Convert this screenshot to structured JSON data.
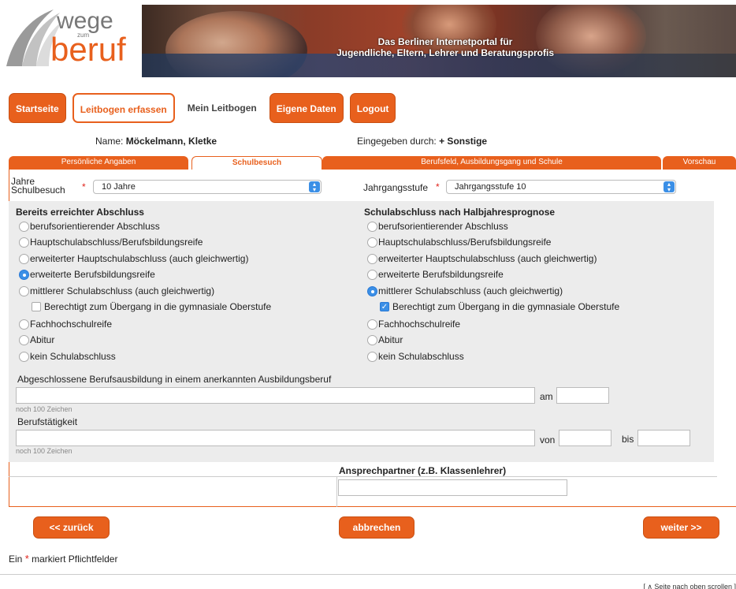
{
  "header": {
    "logo_top": "wege",
    "logo_mid": "zum",
    "logo_bottom": "beruf",
    "banner_line1": "Das Berliner Internetportal für",
    "banner_line2": "Jugendliche, Eltern, Lehrer und Beratungsprofis"
  },
  "nav": {
    "startseite": "Startseite",
    "leitbogen_erfassen": "Leitbogen erfassen",
    "mein_leitbogen": "Mein Leitbogen",
    "eigene_daten": "Eigene Daten",
    "logout": "Logout"
  },
  "info": {
    "name_label": "Name:",
    "name_value": "Möckelmann, Kletke",
    "entered_label": "Eingegeben durch:",
    "entered_value": "+ Sonstige"
  },
  "tabs": [
    {
      "label": "Persönliche Angaben"
    },
    {
      "label": "Schulbesuch"
    },
    {
      "label": "Berufsfeld, Ausbildungsgang und Schule"
    },
    {
      "label": "Vorschau"
    }
  ],
  "form": {
    "jahre_label_1": "Jahre",
    "jahre_label_2": "Schulbesuch",
    "jahre_value": "10 Jahre",
    "jahrgang_label": "Jahrgangsstufe",
    "jahrgang_value": "Jahrgangsstufe 10",
    "left_title": "Bereits erreichter Abschluss",
    "right_title": "Schulabschluss nach Halbjahresprognose",
    "left_options": [
      {
        "label": "berufsorientierender Abschluss",
        "selected": false
      },
      {
        "label": "Hauptschulabschluss/Berufsbildungsreife",
        "selected": false
      },
      {
        "label": "erweiterter Hauptschulabschluss (auch gleichwertig)",
        "selected": false
      },
      {
        "label": "erweiterte Berufsbildungsreife",
        "selected": true
      },
      {
        "label": "mittlerer Schulabschluss (auch gleichwertig)",
        "selected": false
      },
      {
        "label": "Fachhochschulreife",
        "selected": false
      },
      {
        "label": "Abitur",
        "selected": false
      },
      {
        "label": "kein Schulabschluss",
        "selected": false
      }
    ],
    "left_check": {
      "label": "Berechtigt zum Übergang in die gymnasiale Oberstufe",
      "checked": false
    },
    "right_options": [
      {
        "label": "berufsorientierender Abschluss",
        "selected": false
      },
      {
        "label": "Hauptschulabschluss/Berufsbildungsreife",
        "selected": false
      },
      {
        "label": "erweiterter Hauptschulabschluss (auch gleichwertig)",
        "selected": false
      },
      {
        "label": "erweiterte Berufsbildungsreife",
        "selected": false
      },
      {
        "label": "mittlerer Schulabschluss (auch gleichwertig)",
        "selected": true
      },
      {
        "label": "Fachhochschulreife",
        "selected": false
      },
      {
        "label": "Abitur",
        "selected": false
      },
      {
        "label": "kein Schulabschluss",
        "selected": false
      }
    ],
    "right_check": {
      "label": "Berechtigt zum Übergang in die gymnasiale Oberstufe",
      "checked": true
    },
    "ausbildung_label": "Abgeschlossene Berufsausbildung in einem anerkannten Ausbildungsberuf",
    "am_label": "am",
    "hint1": "noch 100 Zeichen",
    "berufstaetigkeit_label": "Berufstätigkeit",
    "von_label": "von",
    "bis_label": "bis",
    "hint2": "noch 100 Zeichen",
    "ansprechpartner_label": "Ansprechpartner (z.B. Klassenlehrer)"
  },
  "buttons": {
    "zurueck": "<< zurück",
    "abbrechen": "abbrechen",
    "weiter": "weiter >>"
  },
  "footer": {
    "ein": "Ein",
    "star": "*",
    "pflicht": "markiert Pflichtfelder",
    "scroll": "[ ∧ Seite nach oben scrollen ]"
  },
  "colors": {
    "accent": "#e8601d",
    "select_blue": "#3b8fe6",
    "required": "#e0231b"
  }
}
